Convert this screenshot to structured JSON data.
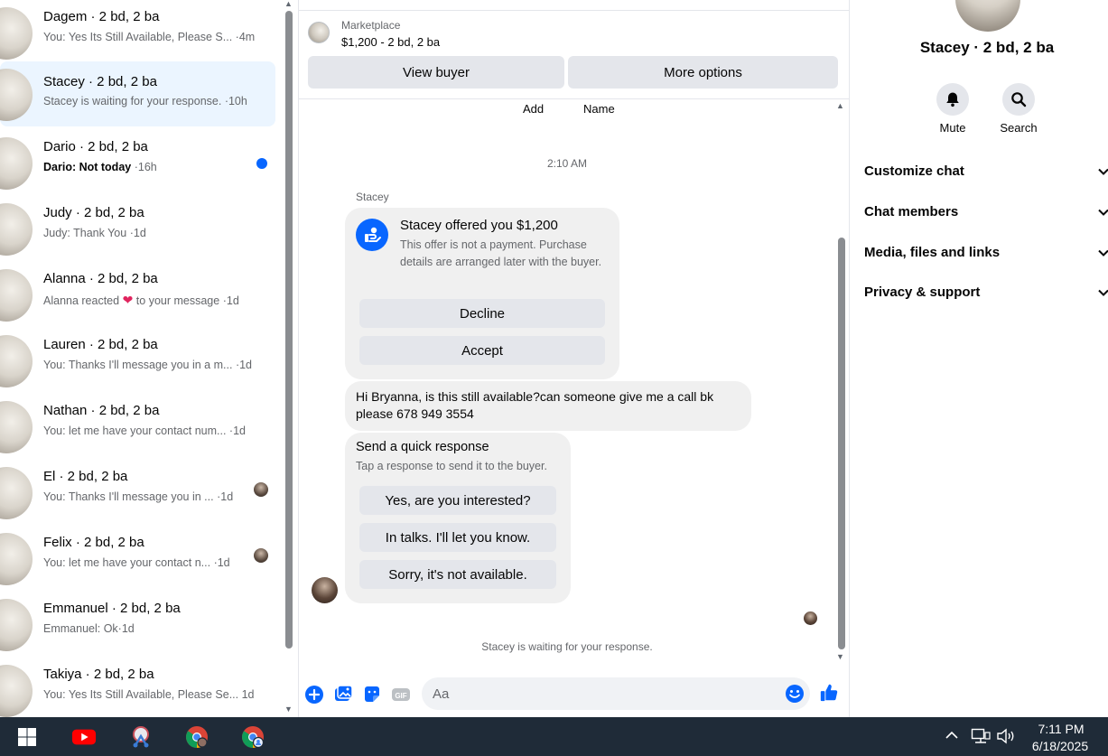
{
  "conversations": [
    {
      "name": "Dagem · 2 bd, 2 ba",
      "preview": "You: Yes Its Still Available, Please S...",
      "time": "·4m"
    },
    {
      "name": "Stacey · 2 bd, 2 ba",
      "preview": "Stacey is waiting for your response.",
      "time": "·10h"
    },
    {
      "name": "Dario · 2 bd, 2 ba",
      "preview": "Dario: Not today",
      "time": "·16h"
    },
    {
      "name": "Judy · 2 bd, 2 ba",
      "preview": "Judy: Thank You",
      "time": "·1d"
    },
    {
      "name": "Alanna · 2 bd, 2 ba",
      "preview_before": "Alanna reacted",
      "preview_after": "to your message",
      "time": "·1d"
    },
    {
      "name": "Lauren · 2 bd, 2 ba",
      "preview": "You: Thanks I'll message you in a m...",
      "time": "·1d"
    },
    {
      "name": "Nathan · 2 bd, 2 ba",
      "preview": "You: let me have your contact num...",
      "time": "·1d"
    },
    {
      "name": "El · 2 bd, 2 ba",
      "preview": "You: Thanks I'll message you in ...",
      "time": "·1d"
    },
    {
      "name": "Felix · 2 bd, 2 ba",
      "preview": "You: let me have your contact n...",
      "time": "·1d"
    },
    {
      "name": "Emmanuel · 2 bd, 2 ba",
      "preview": "Emmanuel: Ok",
      "time": "·1d"
    },
    {
      "name": "Takiya · 2 bd, 2 ba",
      "preview": "You: Yes Its Still Available, Please Se...",
      "time": "1d"
    }
  ],
  "chat": {
    "marketplace_label": "Marketplace",
    "listing_price": "$1,200 - 2 bd, 2 ba",
    "view_buyer": "View buyer",
    "more_options": "More options",
    "add_label": "Add",
    "name_label": "Name",
    "timestamp": "2:10 AM",
    "sender": "Stacey",
    "offer_title": "Stacey offered you $1,200",
    "offer_desc": "This offer is not a payment. Purchase details are arranged later with the buyer.",
    "decline": "Decline",
    "accept": "Accept",
    "message": "Hi Bryanna, is this still available?can someone give me a call bk please 678 949 3554",
    "qr_title": "Send a quick response",
    "qr_sub": "Tap a response to send it to the buyer.",
    "qr_options": [
      "Yes, are you interested?",
      "In talks. I'll let you know.",
      "Sorry, it's not available."
    ],
    "waiting": "Stacey is waiting for your response.",
    "input_placeholder": "Aa"
  },
  "details": {
    "title": "Stacey · 2 bd, 2 ba",
    "mute": "Mute",
    "search": "Search",
    "sections": [
      "Customize chat",
      "Chat members",
      "Media, files and links",
      "Privacy & support"
    ]
  },
  "taskbar": {
    "time": "7:11 PM",
    "date": "6/18/2025"
  },
  "colors": {
    "accent": "#0866ff",
    "active_row": "#ebf5ff",
    "bubble": "#f0f0f0",
    "taskbar": "#1f2b38"
  }
}
